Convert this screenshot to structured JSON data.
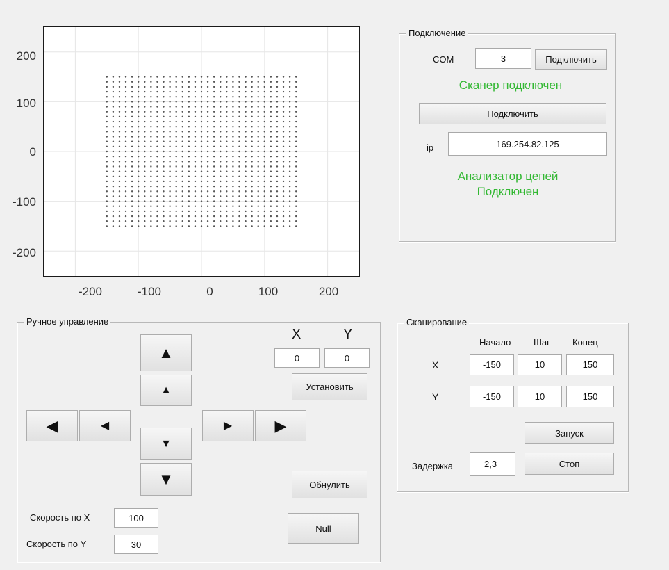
{
  "plot": {
    "y_ticks": [
      "200",
      "100",
      "0",
      "-100",
      "-200"
    ],
    "x_ticks": [
      "-200",
      "-100",
      "0",
      "100",
      "200"
    ]
  },
  "chart_data": {
    "type": "scatter",
    "x_range": [
      -150,
      150
    ],
    "y_range": [
      -150,
      150
    ],
    "step": 10,
    "xlim": [
      -250,
      250
    ],
    "ylim": [
      -250,
      250
    ],
    "grid": true,
    "marker_color": "#555555"
  },
  "connection": {
    "title": "Подключение",
    "com_label": "COM",
    "com_value": "3",
    "connect_com_label": "Подключить",
    "scanner_status": "Сканер подключен",
    "connect_analyzer_label": "Подключить",
    "ip_label": "ip",
    "ip_value": "169.254.82.125",
    "analyzer_status_line1": "Анализатор цепей",
    "analyzer_status_line2": "Подключен",
    "status_color": "#33b833"
  },
  "manual": {
    "title": "Ручное управление",
    "x_header": "X",
    "y_header": "Y",
    "x_value": "0",
    "y_value": "0",
    "set_label": "Установить",
    "reset_label": "Обнулить",
    "null_label": "Null",
    "speed_x_label": "Скорость по X",
    "speed_x_value": "100",
    "speed_y_label": "Скорость по Y",
    "speed_y_value": "30",
    "arrow_up": "▲",
    "arrow_down": "▼",
    "arrow_left": "◀",
    "arrow_right": "▶"
  },
  "scan": {
    "title": "Сканирование",
    "start_header": "Начало",
    "step_header": "Шаг",
    "end_header": "Конец",
    "x_label": "X",
    "y_label": "Y",
    "x_start": "-150",
    "x_step": "10",
    "x_end": "150",
    "y_start": "-150",
    "y_step": "10",
    "y_end": "150",
    "run_label": "Запуск",
    "stop_label": "Стоп",
    "delay_label": "Задержка",
    "delay_value": "2,3"
  }
}
